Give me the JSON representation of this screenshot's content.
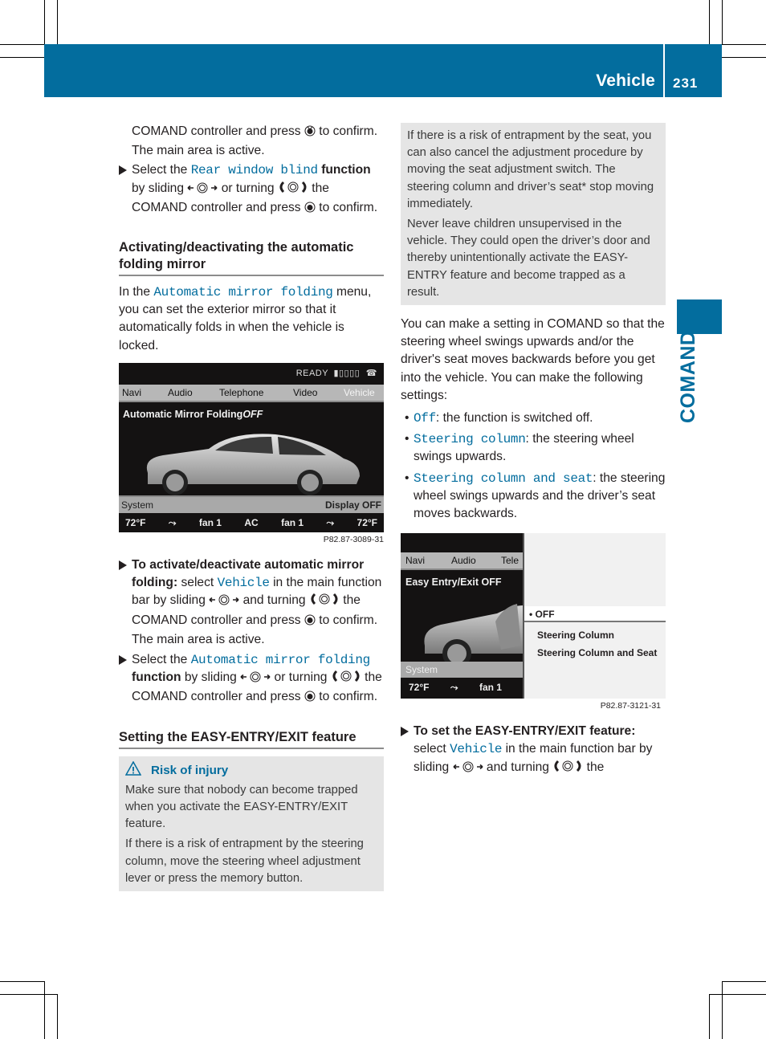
{
  "header": {
    "section": "Vehicle",
    "page_number": "231"
  },
  "side_tab": {
    "label": "COMAND"
  },
  "left_column": {
    "intro_lines": [
      "COMAND controller and press",
      "to confirm.",
      "The main area is active."
    ],
    "step_rear_blind": {
      "pre": "Select the",
      "item": "Rear window blind",
      "bold": "function",
      "p1": "by sliding",
      "p2": "or turning",
      "p3": "the COMAND controller and press",
      "p4": "to confirm."
    },
    "heading_mirror": "Activating/deactivating the automatic folding mirror",
    "mirror_intro": {
      "pre": "In the",
      "item": "Automatic mirror folding",
      "post": "menu, you can set the exterior mirror so that it automatically folds in when the vehicle is locked."
    },
    "screen1": {
      "status": "READY",
      "nav": [
        "Navi",
        "Audio",
        "Telephone",
        "Video",
        "Vehicle"
      ],
      "title": "Automatic Mirror Folding",
      "title_value": "OFF",
      "system_label": "System",
      "display_label": "Display OFF",
      "climate": [
        "72°F",
        "seat-heat-icon",
        "fan 1",
        "AC",
        "fan 1",
        "seat-heat-icon",
        "72°F"
      ],
      "figure_id": "P82.87-3089-31"
    },
    "step_activate": {
      "bold": "To activate/deactivate automatic mirror folding:",
      "pre": "select",
      "item": "Vehicle",
      "p1": "in the main function bar by sliding",
      "p2": "and turning",
      "p3": "the COMAND controller and press",
      "p4": "to confirm.",
      "result": "The main area is active."
    },
    "step_select_mirror": {
      "pre": "Select the",
      "item": "Automatic mirror folding",
      "bold": "function",
      "p1": "by sliding",
      "p2": "or turning",
      "p3": "the COMAND controller and press",
      "p4": "to confirm."
    },
    "heading_easy": "Setting the EASY-ENTRY/EXIT feature",
    "warning": {
      "title": "Risk of injury",
      "p1": "Make sure that nobody can become trapped when you activate the EASY-ENTRY/EXIT feature.",
      "p2": "If there is a risk of entrapment by the steering column, move the steering wheel adjustment lever or press the memory button."
    }
  },
  "right_column": {
    "warning_cont": {
      "p1": "If there is a risk of entrapment by the seat, you can also cancel the adjustment procedure by moving the seat adjustment switch. The steering column and driver’s seat* stop moving immediately.",
      "p2": "Never leave children unsupervised in the vehicle. They could open the driver’s door and thereby unintentionally activate the EASY-ENTRY feature and become trapped as a result."
    },
    "intro": "You can make a setting in COMAND so that the steering wheel swings upwards and/or the driver's seat moves backwards before you get into the vehicle. You can make the following settings:",
    "options": [
      {
        "item": "Off",
        "desc": ": the function is switched off."
      },
      {
        "item": "Steering column",
        "desc": ": the steering wheel swings upwards."
      },
      {
        "item": "Steering column and seat",
        "desc": ": the steering wheel swings upwards and the driver’s seat moves backwards."
      }
    ],
    "screen2": {
      "nav": [
        "Navi",
        "Audio",
        "Tele"
      ],
      "title": "Easy Entry/Exit OFF",
      "system_label": "System",
      "climate": [
        "72°F",
        "seat-heat-icon",
        "fan 1"
      ],
      "menu": [
        "• OFF",
        "Steering Column",
        "Steering Column and Seat"
      ],
      "selected_index": 0,
      "figure_id": "P82.87-3121-31"
    },
    "step_set": {
      "bold": "To set the EASY-ENTRY/EXIT feature:",
      "pre": "select",
      "item": "Vehicle",
      "p1": "in the main function bar by sliding",
      "p2": "and turning",
      "p3": "the"
    }
  },
  "colors": {
    "brand_blue": "#036d9e",
    "warning_bg": "#e5e5e5"
  }
}
